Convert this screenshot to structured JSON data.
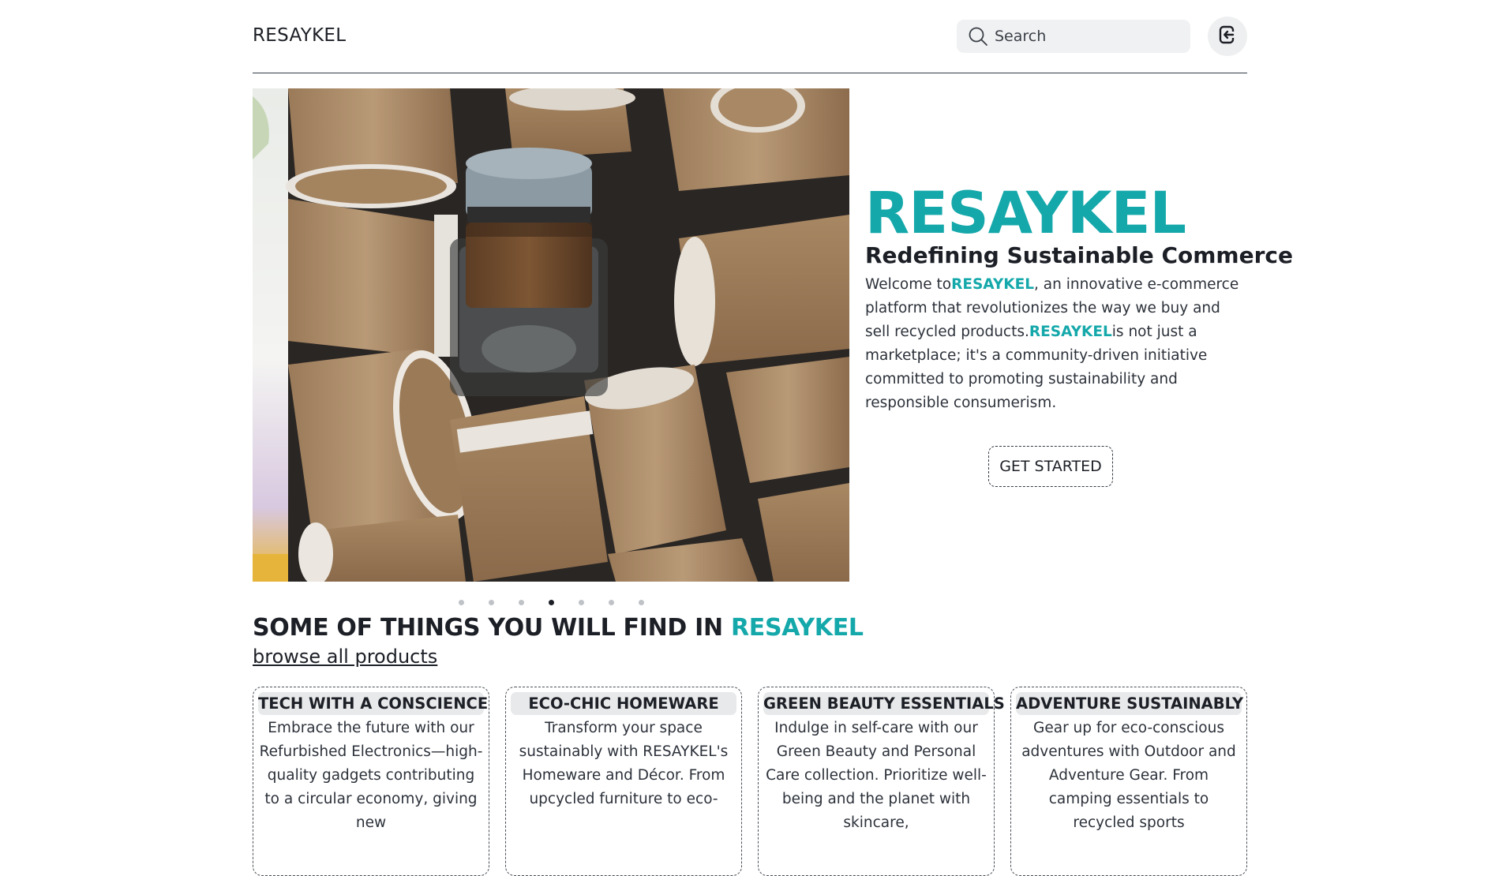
{
  "header": {
    "brand": "RESAYKEL",
    "search_placeholder": "Search"
  },
  "hero": {
    "title": "RESAYKEL",
    "subtitle": "Redefining Sustainable Commerce",
    "desc_part1": "Welcome to",
    "desc_brand1": "RESAYKEL",
    "desc_part2": ", an innovative e-commerce platform that revolutionizes the way we buy and sell recycled products.",
    "desc_brand2": "RESAYKEL",
    "desc_part3": "is not just a marketplace; it's a community-driven initiative committed to promoting sustainability and responsible consumerism.",
    "cta_label": "GET STARTED",
    "carousel_active_index": 3,
    "carousel_count": 7
  },
  "things": {
    "title_prefix": "SOME OF THINGS YOU WILL FIND IN ",
    "title_accent": "RESAYKEL",
    "browse_link": "browse all products",
    "cards": [
      {
        "title": "TECH WITH A CONSCIENCE",
        "text": "Embrace the future with our Refurbished Electronics—high-quality gadgets contributing to a circular economy, giving new"
      },
      {
        "title": "ECO-CHIC HOMEWARE",
        "text": "Transform your space sustainably with RESAYKEL's Homeware and Décor. From upcycled furniture to eco-"
      },
      {
        "title": "GREEN BEAUTY ESSENTIALS",
        "text": "Indulge in self-care with our Green Beauty and Personal Care collection. Prioritize well-being and the planet with skincare,"
      },
      {
        "title": "ADVENTURE SUSTAINABLY",
        "text": "Gear up for eco-conscious adventures with Outdoor and Adventure Gear. From camping essentials to recycled sports"
      }
    ]
  },
  "colors": {
    "accent": "#15a8aa",
    "text": "#1c1f26"
  },
  "icons": {
    "search": "search-icon",
    "login": "login-icon"
  }
}
